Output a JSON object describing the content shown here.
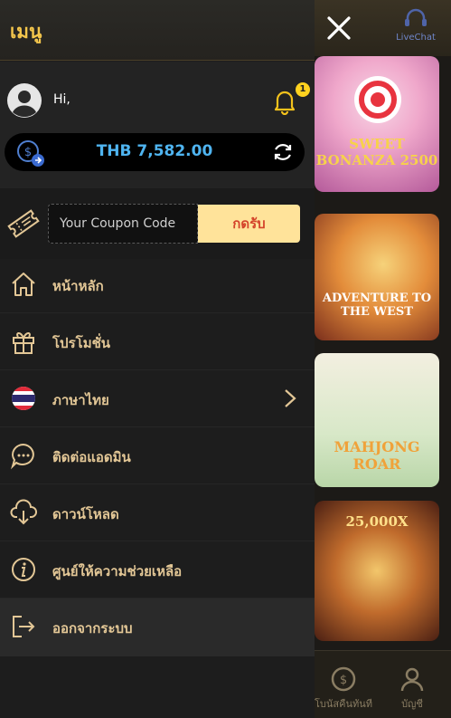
{
  "drawer": {
    "title": "เมนู",
    "user": {
      "greeting": "Hi,",
      "notification_count": "1"
    },
    "balance": {
      "text": "THB 7,582.00"
    },
    "coupon": {
      "placeholder": "Your Coupon Code",
      "button_label": "กดรับ"
    },
    "menu_items": [
      {
        "icon": "home-icon",
        "label": "หน้าหลัก"
      },
      {
        "icon": "gift-icon",
        "label": "โปรโมชั่น"
      },
      {
        "icon": "thai-flag-icon",
        "label": "ภาษาไทย"
      },
      {
        "icon": "chat-bubble-icon",
        "label": "ติดต่อแอดมิน"
      },
      {
        "icon": "cloud-download-icon",
        "label": "ดาวน์โหลด"
      },
      {
        "icon": "info-icon",
        "label": "ศูนย์ให้ความช่วยเหลือ"
      },
      {
        "icon": "logout-icon",
        "label": "ออกจากระบบ"
      }
    ]
  },
  "background": {
    "live_chat_label": "LiveChat",
    "tiles": [
      {
        "title": "SWEET BONANZA 2500"
      },
      {
        "title": "ADVENTURE TO THE WEST"
      },
      {
        "title": "MAHJONG ROAR"
      },
      {
        "title": "25,000X"
      }
    ],
    "bottom_nav": [
      {
        "label": "โบนัสคืนทันที"
      },
      {
        "label": "บัญชี"
      }
    ]
  },
  "colors": {
    "accent_gold": "#f4c64c",
    "menu_text": "#e3c796",
    "balance_blue": "#4fb4f0",
    "coupon_button_bg": "#ffe39a"
  }
}
